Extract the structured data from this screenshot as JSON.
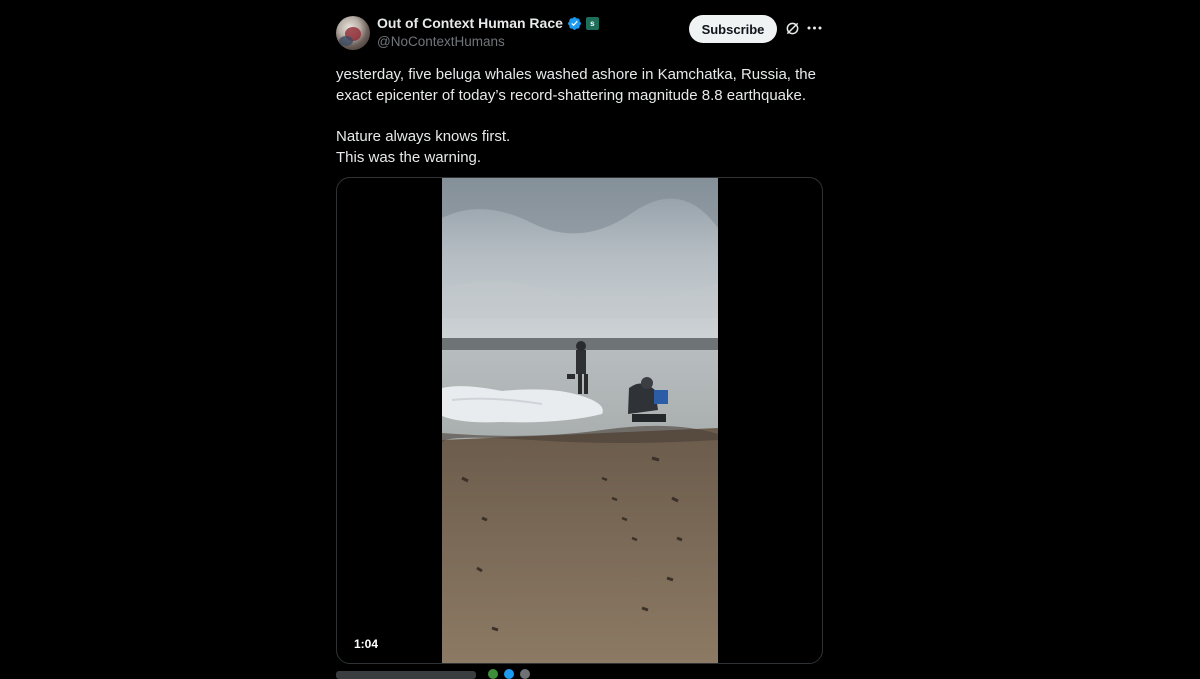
{
  "author": {
    "display_name": "Out of Context Human Race",
    "handle": "@NoContextHumans",
    "avatar": "avatar-image",
    "verified_icon": "verified-badge-icon",
    "affiliate_icon": "affiliate-badge-icon"
  },
  "actions": {
    "subscribe_label": "Subscribe",
    "grok_icon": "grok-icon",
    "more_icon": "more-options-icon"
  },
  "post": {
    "paragraph1_line1": "yesterday, five beluga whales washed ashore in Kamchatka, Russia, the",
    "paragraph1_line2": "exact epicenter of today’s record-shattering magnitude 8.8 earthquake.",
    "paragraph2_line1": "Nature always knows first.",
    "paragraph2_line2": "This was the warning."
  },
  "media": {
    "type": "video",
    "duration": "1:04"
  },
  "colors": {
    "background": "#000000",
    "text_primary": "#e7e9ea",
    "text_secondary": "#71767b",
    "verified_blue": "#1d9bf0",
    "subscribe_bg": "#eff3f4",
    "border": "#2f3336"
  }
}
